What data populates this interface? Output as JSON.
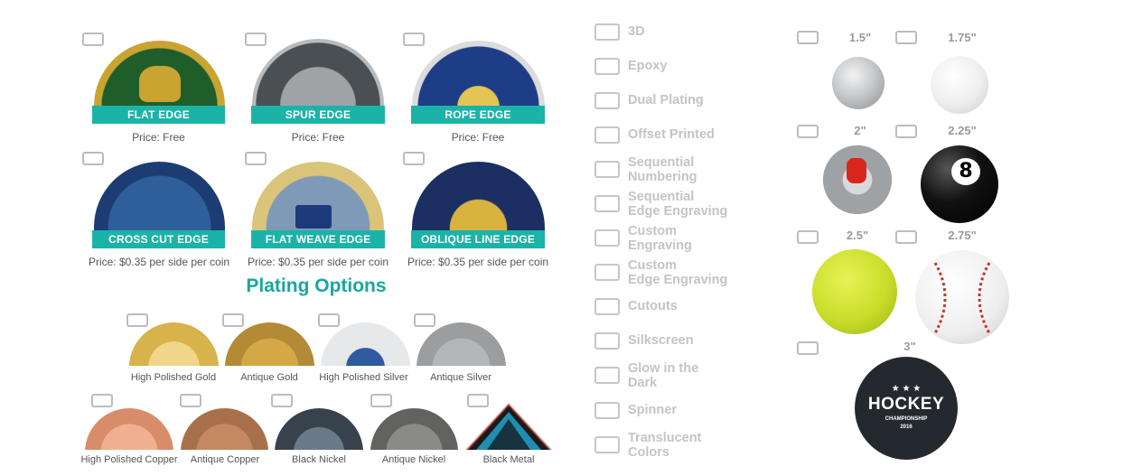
{
  "edges": [
    {
      "label": "FLAT EDGE",
      "price": "Price: Free",
      "colors": [
        "#1f5e2a",
        "#c9a431"
      ]
    },
    {
      "label": "SPUR EDGE",
      "price": "Price: Free",
      "colors": [
        "#555a5f",
        "#c9ccd0"
      ]
    },
    {
      "label": "ROPE EDGE",
      "price": "Price: Free",
      "colors": [
        "#1d3e86",
        "#c9c9c9"
      ]
    },
    {
      "label": "CROSS CUT EDGE",
      "price": "Price: $0.35 per side per coin",
      "colors": [
        "#1c3c74",
        "#c9a431"
      ]
    },
    {
      "label": "FLAT WEAVE EDGE",
      "price": "Price: $0.35 per side per coin",
      "colors": [
        "#5f7fa4",
        "#c9a431"
      ]
    },
    {
      "label": "OBLIQUE LINE EDGE",
      "price": "Price: $0.35 per side per coin",
      "colors": [
        "#1c2f63",
        "#c9a431"
      ]
    }
  ],
  "plating": {
    "title": "Plating Options",
    "row1": [
      {
        "label": "High Polished Gold",
        "color": "#d8b24a"
      },
      {
        "label": "Antique Gold",
        "color": "#b38a35"
      },
      {
        "label": "High Polished Silver",
        "color": "#c8cacc"
      },
      {
        "label": "Antique Silver",
        "color": "#9b9d9e"
      }
    ],
    "row2": [
      {
        "label": "High Polished Copper",
        "color": "#d98c6a"
      },
      {
        "label": "Antique Copper",
        "color": "#a8704a"
      },
      {
        "label": "Black Nickel",
        "color": "#37424d"
      },
      {
        "label": "Antique Nickel",
        "color": "#626260"
      },
      {
        "label": "Black Metal",
        "color": "#1a1a1a"
      }
    ]
  },
  "options": [
    "3D",
    "Epoxy",
    "Dual Plating",
    "Offset Printed",
    "Sequential Numbering",
    "Sequential Edge Engraving",
    "Custom Engraving",
    "Custom Edge Engraving",
    "Cutouts",
    "Silkscreen",
    "Glow in the Dark",
    "Spinner",
    "Translucent Colors"
  ],
  "options_lines": [
    [
      "3D"
    ],
    [
      "Epoxy"
    ],
    [
      "Dual Plating"
    ],
    [
      "Offset Printed"
    ],
    [
      "Sequential",
      "Numbering"
    ],
    [
      "Sequential",
      "Edge Engraving"
    ],
    [
      "Custom",
      "Engraving"
    ],
    [
      "Custom",
      "Edge Engraving"
    ],
    [
      "Cutouts"
    ],
    [
      "Silkscreen"
    ],
    [
      "Glow in the",
      "Dark"
    ],
    [
      "Spinner"
    ],
    [
      "Translucent",
      "Colors"
    ]
  ],
  "sizes": [
    {
      "label": "1.5\"",
      "object": "silver-dollar-icon"
    },
    {
      "label": "1.75\"",
      "object": "golf-ball-icon"
    },
    {
      "label": "2\"",
      "object": "soda-can-top-icon"
    },
    {
      "label": "2.25\"",
      "object": "eight-ball-icon"
    },
    {
      "label": "2.5\"",
      "object": "tennis-ball-icon"
    },
    {
      "label": "2.75\"",
      "object": "baseball-icon"
    },
    {
      "label": "3\"",
      "object": "hockey-puck-icon"
    }
  ],
  "puck": {
    "title": "HOCKEY",
    "subtitle": "CHAMPIONSHIP",
    "year": "2016",
    "stars": "★ ★ ★"
  },
  "eight_ball_number": "8"
}
